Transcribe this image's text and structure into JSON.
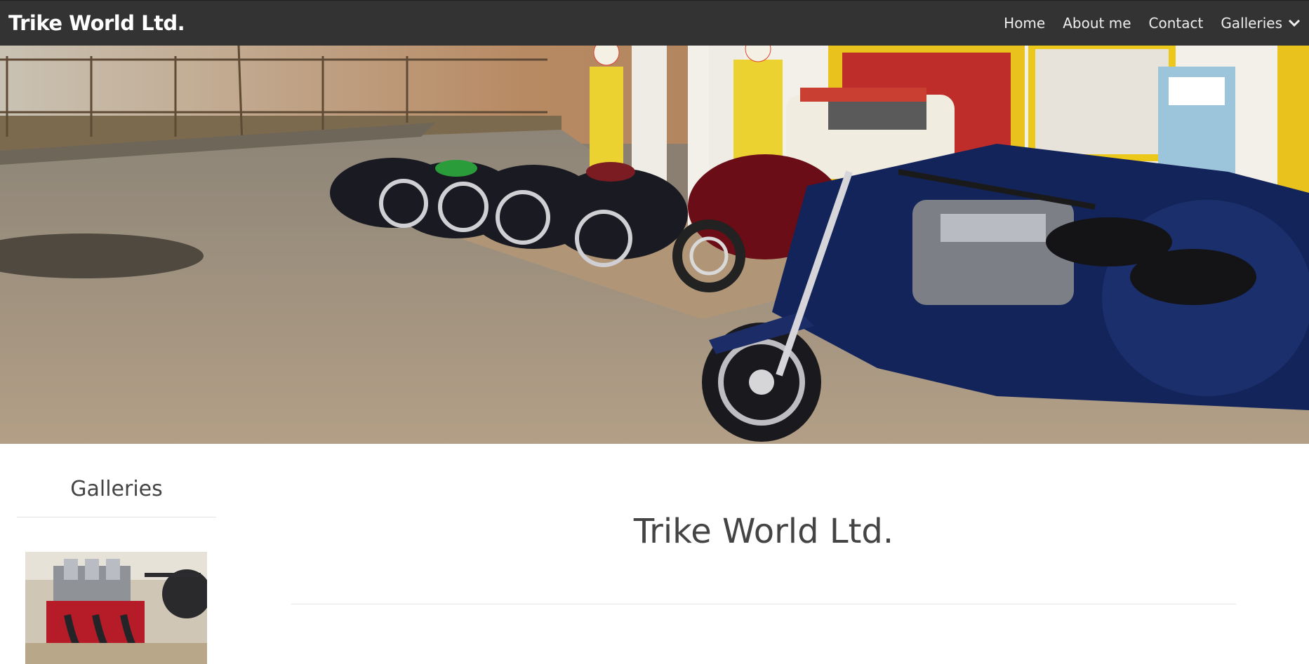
{
  "navbar": {
    "brand": "Trike World Ltd.",
    "items": [
      {
        "label": "Home"
      },
      {
        "label": "About me"
      },
      {
        "label": "Contact"
      },
      {
        "label": "Galleries",
        "has_dropdown": true
      }
    ],
    "background": "#333333"
  },
  "hero": {
    "description_icon": "photo"
  },
  "sidebar": {
    "title": "Galleries"
  },
  "main": {
    "title": "Trike World Ltd."
  }
}
